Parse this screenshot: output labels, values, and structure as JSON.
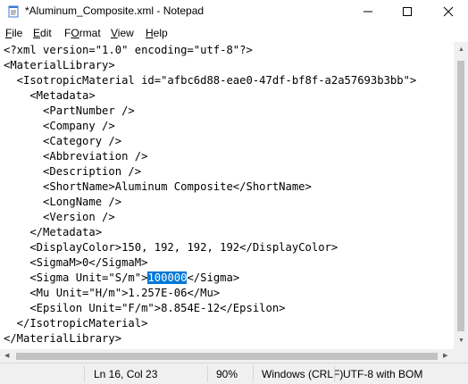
{
  "window": {
    "title": "*Aluminum_Composite.xml - Notepad",
    "controls": {
      "minimize": "─",
      "maximize": "☐",
      "close": "✕"
    }
  },
  "menu": [
    {
      "key": "F",
      "rest": "ile"
    },
    {
      "key": "E",
      "rest": "dit"
    },
    {
      "key": "O",
      "rest": "rmat",
      "prefix": "F"
    },
    {
      "key": "V",
      "rest": "iew"
    },
    {
      "key": "H",
      "rest": "elp"
    }
  ],
  "menu_labels": [
    "File",
    "Edit",
    "Format",
    "View",
    "Help"
  ],
  "editor": {
    "lines": [
      "<?xml version=\"1.0\" encoding=\"utf-8\"?>",
      "<MaterialLibrary>",
      "  <IsotropicMaterial id=\"afbc6d88-eae0-47df-bf8f-a2a57693b3bb\">",
      "    <Metadata>",
      "      <PartNumber />",
      "      <Company />",
      "      <Category />",
      "      <Abbreviation />",
      "      <Description />",
      "      <ShortName>Aluminum Composite</ShortName>",
      "      <LongName />",
      "      <Version />",
      "    </Metadata>",
      "    <DisplayColor>150, 192, 192, 192</DisplayColor>",
      "    <SigmaM>0</SigmaM>",
      "    <Sigma Unit=\"S/m\">100000</Sigma>",
      "    <Mu Unit=\"H/m\">1.257E-06</Mu>",
      "    <Epsilon Unit=\"F/m\">8.854E-12</Epsilon>",
      "  </IsotropicMaterial>",
      "</MaterialLibrary>"
    ],
    "selection": {
      "line": 15,
      "before": "    <Sigma Unit=\"S/m\">",
      "selected": "100000",
      "after": "</Sigma>"
    }
  },
  "status": {
    "position": "Ln 16, Col 23",
    "zoom": "90%",
    "line_ending": "Windows (CRLF)",
    "encoding": "UTF-8 with BOM"
  },
  "colors": {
    "selection": "#0078d7",
    "statusbar": "#f0f0f0"
  }
}
